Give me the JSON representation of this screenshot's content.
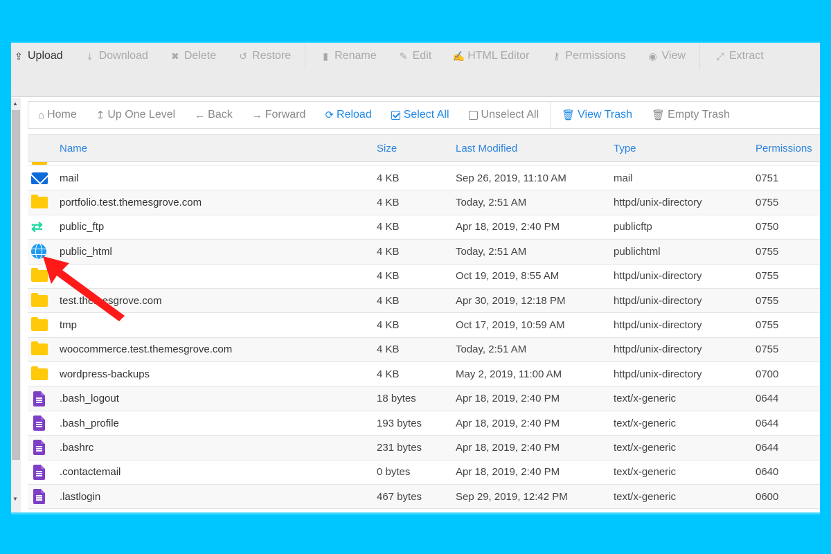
{
  "toolbar": {
    "items": [
      {
        "label": "Upload",
        "icon": "upload-icon",
        "enabled": true
      },
      {
        "label": "Download",
        "icon": "download-icon",
        "enabled": false
      },
      {
        "label": "Delete",
        "icon": "delete-icon",
        "enabled": false
      },
      {
        "label": "Restore",
        "icon": "restore-icon",
        "enabled": false
      },
      {
        "label": "Rename",
        "icon": "rename-icon",
        "enabled": false
      },
      {
        "label": "Edit",
        "icon": "edit-icon",
        "enabled": false
      },
      {
        "label": "HTML Editor",
        "icon": "html-editor-icon",
        "enabled": false
      },
      {
        "label": "Permissions",
        "icon": "key-icon",
        "enabled": false
      },
      {
        "label": "View",
        "icon": "eye-icon",
        "enabled": false
      },
      {
        "label": "Extract",
        "icon": "extract-icon",
        "enabled": false
      }
    ]
  },
  "nav": {
    "home": "Home",
    "up": "Up One Level",
    "back": "Back",
    "forward": "Forward",
    "reload": "Reload",
    "select_all": "Select All",
    "unselect_all": "Unselect All",
    "view_trash": "View Trash",
    "empty_trash": "Empty Trash"
  },
  "table": {
    "headers": {
      "name": "Name",
      "size": "Size",
      "modified": "Last Modified",
      "type": "Type",
      "permissions": "Permissions"
    },
    "rows": [
      {
        "icon": "mail",
        "name": "mail",
        "size": "4 KB",
        "modified": "Sep 26, 2019, 11:10 AM",
        "type": "mail",
        "perm": "0751"
      },
      {
        "icon": "folder",
        "name": "portfolio.test.themesgrove.com",
        "size": "4 KB",
        "modified": "Today, 2:51 AM",
        "type": "httpd/unix-directory",
        "perm": "0755"
      },
      {
        "icon": "ftp",
        "name": "public_ftp",
        "size": "4 KB",
        "modified": "Apr 18, 2019, 2:40 PM",
        "type": "publicftp",
        "perm": "0750"
      },
      {
        "icon": "globe",
        "name": "public_html",
        "size": "4 KB",
        "modified": "Today, 2:51 AM",
        "type": "publichtml",
        "perm": "0755"
      },
      {
        "icon": "folder",
        "name": "",
        "size": "4 KB",
        "modified": "Oct 19, 2019, 8:55 AM",
        "type": "httpd/unix-directory",
        "perm": "0755"
      },
      {
        "icon": "folder",
        "name": "test.themesgrove.com",
        "size": "4 KB",
        "modified": "Apr 30, 2019, 12:18 PM",
        "type": "httpd/unix-directory",
        "perm": "0755"
      },
      {
        "icon": "folder",
        "name": "tmp",
        "size": "4 KB",
        "modified": "Oct 17, 2019, 10:59 AM",
        "type": "httpd/unix-directory",
        "perm": "0755"
      },
      {
        "icon": "folder",
        "name": "woocommerce.test.themesgrove.com",
        "size": "4 KB",
        "modified": "Today, 2:51 AM",
        "type": "httpd/unix-directory",
        "perm": "0755"
      },
      {
        "icon": "folder",
        "name": "wordpress-backups",
        "size": "4 KB",
        "modified": "May 2, 2019, 11:00 AM",
        "type": "httpd/unix-directory",
        "perm": "0700"
      },
      {
        "icon": "file",
        "name": ".bash_logout",
        "size": "18 bytes",
        "modified": "Apr 18, 2019, 2:40 PM",
        "type": "text/x-generic",
        "perm": "0644"
      },
      {
        "icon": "file",
        "name": ".bash_profile",
        "size": "193 bytes",
        "modified": "Apr 18, 2019, 2:40 PM",
        "type": "text/x-generic",
        "perm": "0644"
      },
      {
        "icon": "file",
        "name": ".bashrc",
        "size": "231 bytes",
        "modified": "Apr 18, 2019, 2:40 PM",
        "type": "text/x-generic",
        "perm": "0644"
      },
      {
        "icon": "file",
        "name": ".contactemail",
        "size": "0 bytes",
        "modified": "Apr 18, 2019, 2:40 PM",
        "type": "text/x-generic",
        "perm": "0640"
      },
      {
        "icon": "file",
        "name": ".lastlogin",
        "size": "467 bytes",
        "modified": "Sep 29, 2019, 12:42 PM",
        "type": "text/x-generic",
        "perm": "0600"
      }
    ]
  },
  "colors": {
    "accent": "#1e88e5",
    "background": "#00c6ff",
    "annotation_arrow": "#ff1a1a"
  }
}
